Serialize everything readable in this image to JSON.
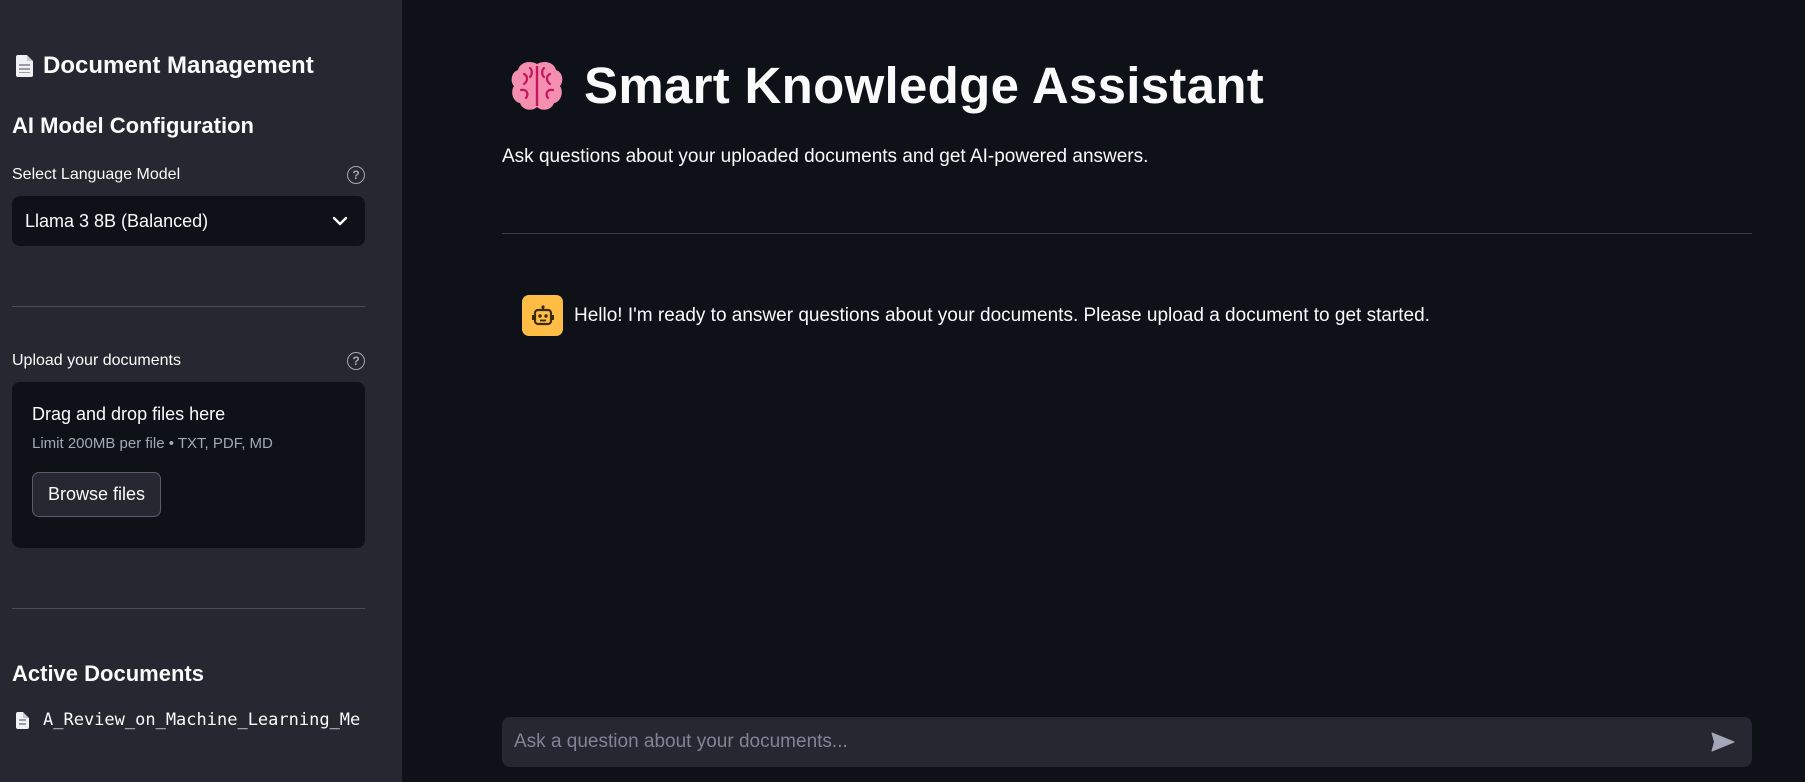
{
  "sidebar": {
    "title": "Document Management",
    "model_section": {
      "heading": "AI Model Configuration",
      "label": "Select Language Model",
      "selected": "Llama 3 8B (Balanced)"
    },
    "upload": {
      "label": "Upload your documents",
      "drop_text": "Drag and drop files here",
      "limit_text": "Limit 200MB per file • TXT, PDF, MD",
      "browse_label": "Browse files"
    },
    "active_docs": {
      "heading": "Active Documents",
      "items": [
        "A_Review_on_Machine_Learning_Me"
      ]
    }
  },
  "main": {
    "title": "Smart Knowledge Assistant",
    "subtitle": "Ask questions about your uploaded documents and get AI-powered answers.",
    "messages": [
      {
        "role": "assistant",
        "text": "Hello! I'm ready to answer questions about your documents. Please upload a document to get started."
      }
    ],
    "chat_input": {
      "placeholder": "Ask a question about your documents...",
      "value": ""
    }
  },
  "colors": {
    "sidebar_bg": "#262730",
    "main_bg": "#0e1117",
    "bot_avatar": "#ffbd45",
    "brain": "#f48fb1"
  },
  "icons": {
    "sidebar_title": "document-icon",
    "help": "help-circle-icon",
    "dropdown": "chevron-down-icon",
    "brain": "brain-icon",
    "bot": "robot-icon",
    "send": "send-icon"
  }
}
